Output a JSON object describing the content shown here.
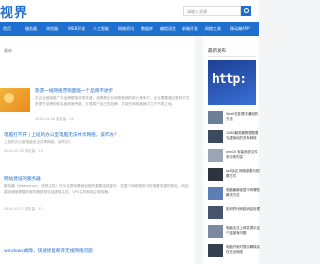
{
  "header": {
    "logo": "视界",
    "search_placeholder": "请输入关键"
  },
  "nav": {
    "items": [
      "首页",
      "服务器",
      "浏览器",
      "WEB开发",
      "人工智能",
      "网络资讯",
      "数据库",
      "编程语言",
      "前端开发",
      "网络工具",
      "移动端APP"
    ]
  },
  "main": {
    "section_label": "最新",
    "articles": [
      {
        "title": "旅游一线网络营销面临一个品牌不进步",
        "desc": "在企业营销推广中品牌塑造非常关键，品牌是企业网络营销的核心竞争力，企业需要通过各种方式来提升品牌的知名度和美誉度，打造属于自己的品牌，才能在网络营销中立于不败之地。",
        "meta": "2024-03-18   浏览量：15"
      },
      {
        "title": "电脑打不开 | 上班的办公室电脑无法共享网络，该咋办？",
        "desc": "上班的办公室电脑无法共享网络，该咋办？",
        "meta": "2024-03-18   浏览量：13"
      },
      {
        "title": "网站建设的服务器",
        "desc": "服务器（Webserver，也称主机）作为互联网基础设施的重要组成部分，在整个网络服务中扮演着关键的角色。网站建设通常需要的服务器类型包括虚拟主机、VPS主机和独立服务器。",
        "meta": "2024-03-17   浏览量：11"
      },
      {
        "title": "windows故障，快速修复断开无线网络问题",
        "desc": "",
        "meta": ""
      }
    ]
  },
  "sidebar": {
    "title": "最新发布",
    "banner_text": "http:",
    "items": [
      {
        "title": "Shell在处理中通用的方法"
      },
      {
        "title": "1280服务器物理配置与虚拟化的关系网络"
      },
      {
        "title": "win10 安装系统文件夹中的内容"
      },
      {
        "title": "ip4协议  网络参数与配置方式"
      },
      {
        "title": "电脑最新版显卡有哪些解决方法"
      },
      {
        "title": "如何时代网络消息处理"
      },
      {
        "title": "电脑无法上网并提示这个连接有问题"
      },
      {
        "title": "电脑开机时提示解除实在无法网络"
      }
    ]
  }
}
